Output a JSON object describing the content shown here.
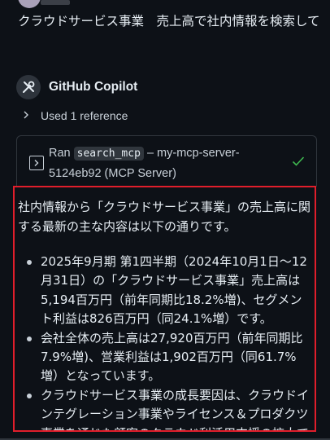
{
  "user_message": "クラウドサービス事業　売上高で社内情報を検索して",
  "copilot": {
    "name": "GitHub Copilot"
  },
  "references": {
    "label": "Used 1 reference"
  },
  "tool_call": {
    "prefix": "Ran",
    "tool": "search_mcp",
    "suffix": "– my-mcp-server-5124eb92 (MCP Server)"
  },
  "answer": {
    "intro": "社内情報から「クラウドサービス事業」の売上高に関する最新の主な内容は以下の通りです。",
    "bullets": [
      "2025年9月期 第1四半期（2024年10月1日〜12月31日）の「クラウドサービス事業」売上高は5,194百万円（前年同期比18.2%増)、セグメント利益は826百万円（同24.1%増）です。",
      "会社全体の売上高は27,920百万円（前年同期比7.9%増)、営業利益は1,902百万円（同61.7%増）となっています。",
      "クラウドサービス事業の成長要因は、クラウドインテグレーション事業やライセンス＆プロダクツ事業を通じた顧客のクラウド利活用支援の拡大で"
    ]
  },
  "colors": {
    "background": "#0d1117",
    "highlight": "#e01e2b",
    "check": "#3fb950"
  }
}
